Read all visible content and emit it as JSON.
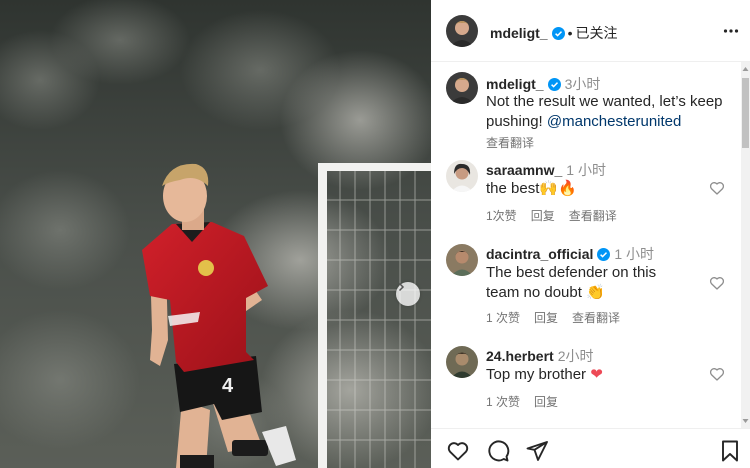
{
  "post_author": {
    "username": "mdeligt_",
    "follow_status": "已关注"
  },
  "caption": {
    "username": "mdeligt_",
    "time": "3小时",
    "text": "Not the result we wanted, let’s keep pushing! ",
    "mention": "@manchesterunited",
    "translate": "查看翻译"
  },
  "comments": [
    {
      "username": "saraamnw_",
      "time": "1 小时",
      "text": "the best",
      "emoji": "🙌🔥",
      "likes": "1次赞",
      "reply": "回复",
      "translate": "查看翻译"
    },
    {
      "username": "dacintra_official",
      "time": "1 小时",
      "text": "The best defender on this team no doubt",
      "emoji": "👏",
      "likes": "1 次赞",
      "reply": "回复",
      "translate": "查看翻译"
    },
    {
      "username": "24.herbert",
      "time": "2小时",
      "text": "Top my brother",
      "emoji": "❤",
      "likes": "1 次赞",
      "reply": "回复"
    }
  ],
  "icons": {
    "verified": "verified-badge-icon",
    "more": "more-options-icon",
    "like": "heart-icon",
    "comment": "comment-icon",
    "share": "send-icon",
    "save": "bookmark-icon",
    "next": "chevron-right-icon"
  },
  "colors": {
    "verified": "#0095f6",
    "link": "#00376b",
    "muted": "#737373",
    "heart_red": "#ed4956"
  }
}
